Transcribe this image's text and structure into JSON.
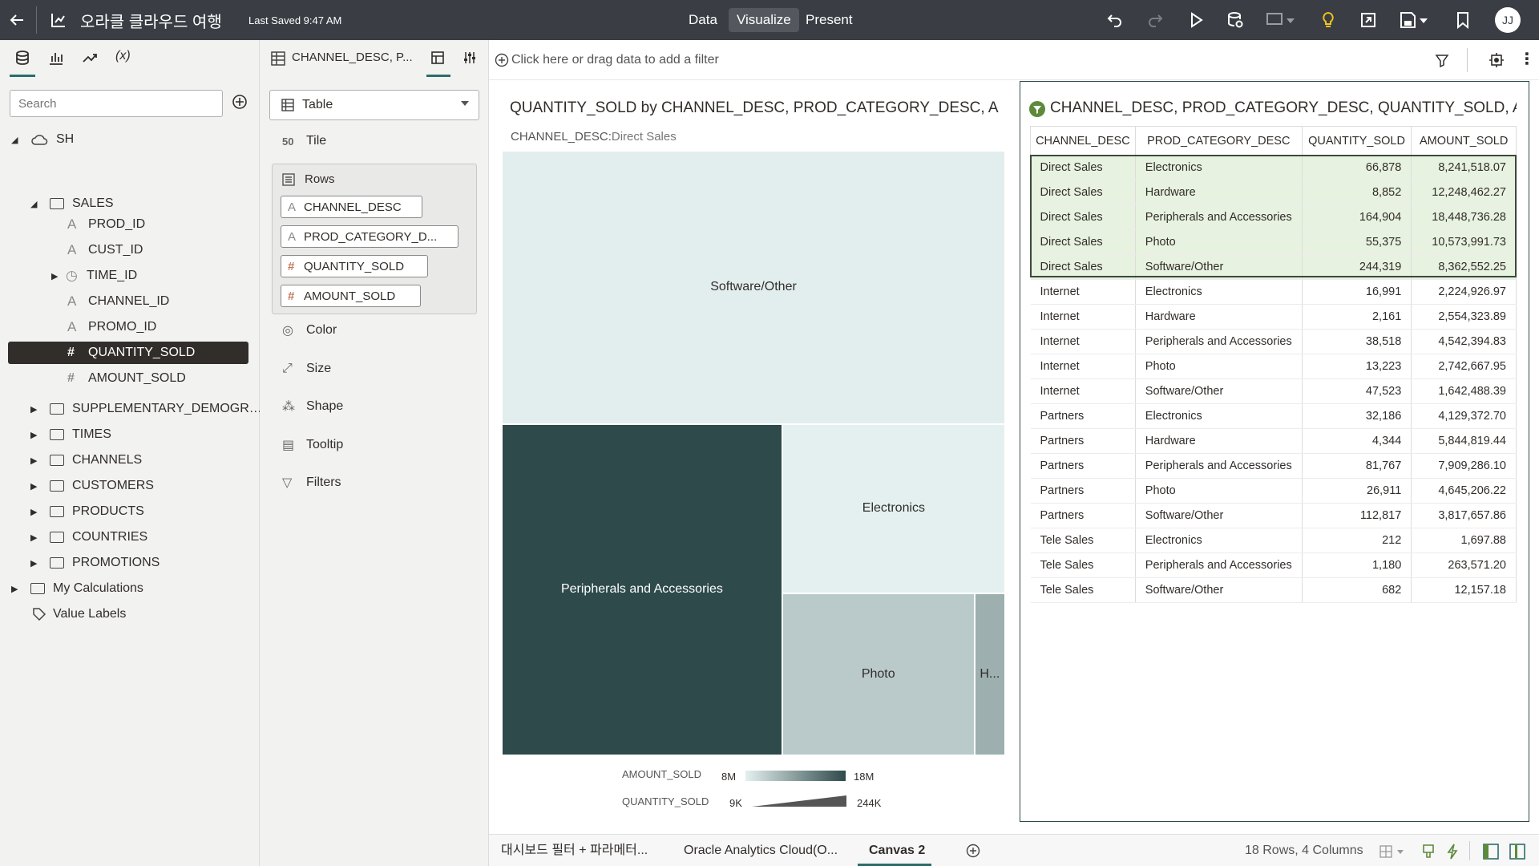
{
  "app": {
    "title": "오라클 클라우드 여행",
    "last_saved": "Last Saved 9:47 AM",
    "tabs": [
      "Data",
      "Visualize",
      "Present"
    ],
    "active_tab": "Visualize",
    "user_initials": "JJ"
  },
  "left_panel": {
    "icons": [
      "data-icon",
      "visualizations-icon",
      "analytics-icon",
      "calculations-icon"
    ],
    "calc_label": "(x)",
    "search_placeholder": "Search",
    "tree": {
      "root": "SH",
      "sales_folder": "SALES",
      "sales_columns": [
        {
          "label": "PROD_ID",
          "type": "text"
        },
        {
          "label": "CUST_ID",
          "type": "text"
        },
        {
          "label": "TIME_ID",
          "type": "time"
        },
        {
          "label": "CHANNEL_ID",
          "type": "text"
        },
        {
          "label": "PROMO_ID",
          "type": "text"
        },
        {
          "label": "QUANTITY_SOLD",
          "type": "number",
          "selected": true
        },
        {
          "label": "AMOUNT_SOLD",
          "type": "number"
        }
      ],
      "folders": [
        "SUPPLEMENTARY_DEMOGR…",
        "TIMES",
        "CHANNELS",
        "CUSTOMERS",
        "PRODUCTS",
        "COUNTRIES",
        "PROMOTIONS"
      ],
      "my_calculations": "My Calculations",
      "value_labels": "Value Labels"
    }
  },
  "grammar": {
    "header": "CHANNEL_DESC, P...",
    "viz_type": "Table",
    "tile": "Tile",
    "rows_label": "Rows",
    "row_pills": [
      {
        "label": "CHANNEL_DESC",
        "type": "text"
      },
      {
        "label": "PROD_CATEGORY_D...",
        "type": "text"
      },
      {
        "label": "QUANTITY_SOLD",
        "type": "number"
      },
      {
        "label": "AMOUNT_SOLD",
        "type": "number"
      }
    ],
    "sections": [
      "Color",
      "Size",
      "Shape",
      "Tooltip",
      "Filters"
    ]
  },
  "filter_bar": {
    "placeholder": "Click here or drag data to add a filter"
  },
  "treemap": {
    "title": "QUANTITY_SOLD by CHANNEL_DESC, PROD_CATEGORY_DESC, AMOU...",
    "subtitle_key": "CHANNEL_DESC:",
    "subtitle_value": "Direct Sales",
    "color_legend": {
      "label": "AMOUNT_SOLD",
      "min": "8M",
      "max": "18M"
    },
    "size_legend": {
      "label": "QUANTITY_SOLD",
      "min": "9K",
      "max": "244K"
    },
    "colors": {
      "light": "#e4f0f0",
      "dark": "#2e4a4a",
      "mid": "#b3d5d4",
      "teal": "#92c1bf"
    }
  },
  "table_viz": {
    "title": "CHANNEL_DESC, PROD_CATEGORY_DESC, QUANTITY_SOLD, AMOU...",
    "columns": [
      "CHANNEL_DESC",
      "PROD_CATEGORY_DESC",
      "QUANTITY_SOLD",
      "AMOUNT_SOLD"
    ],
    "rows": [
      [
        "Direct Sales",
        "Electronics",
        "66,878",
        "8,241,518.07"
      ],
      [
        "Direct Sales",
        "Hardware",
        "8,852",
        "12,248,462.27"
      ],
      [
        "Direct Sales",
        "Peripherals and Accessories",
        "164,904",
        "18,448,736.28"
      ],
      [
        "Direct Sales",
        "Photo",
        "55,375",
        "10,573,991.73"
      ],
      [
        "Direct Sales",
        "Software/Other",
        "244,319",
        "8,362,552.25"
      ],
      [
        "Internet",
        "Electronics",
        "16,991",
        "2,224,926.97"
      ],
      [
        "Internet",
        "Hardware",
        "2,161",
        "2,554,323.89"
      ],
      [
        "Internet",
        "Peripherals and Accessories",
        "38,518",
        "4,542,394.83"
      ],
      [
        "Internet",
        "Photo",
        "13,223",
        "2,742,667.95"
      ],
      [
        "Internet",
        "Software/Other",
        "47,523",
        "1,642,488.39"
      ],
      [
        "Partners",
        "Electronics",
        "32,186",
        "4,129,372.70"
      ],
      [
        "Partners",
        "Hardware",
        "4,344",
        "5,844,819.44"
      ],
      [
        "Partners",
        "Peripherals and Accessories",
        "81,767",
        "7,909,286.10"
      ],
      [
        "Partners",
        "Photo",
        "26,911",
        "4,645,206.22"
      ],
      [
        "Partners",
        "Software/Other",
        "112,817",
        "3,817,657.86"
      ],
      [
        "Tele Sales",
        "Electronics",
        "212",
        "1,697.88"
      ],
      [
        "Tele Sales",
        "Peripherals and Accessories",
        "1,180",
        "263,571.20"
      ],
      [
        "Tele Sales",
        "Software/Other",
        "682",
        "12,157.18"
      ]
    ],
    "selected_rows": 5
  },
  "bottom": {
    "canvas_tabs": [
      "대시보드 필터 + 파라메터...",
      "Oracle Analytics Cloud(O...",
      "Canvas 2"
    ],
    "active_canvas": "Canvas 2",
    "status": "18 Rows, 4 Columns"
  },
  "chart_data": {
    "type": "treemap",
    "title": "QUANTITY_SOLD by CHANNEL_DESC, PROD_CATEGORY_DESC, AMOU...",
    "filter": "CHANNEL_DESC: Direct Sales",
    "categories": [
      "Software/Other",
      "Peripherals and Accessories",
      "Electronics",
      "Photo",
      "Hardware"
    ],
    "tile_labels": [
      "Software/Other",
      "Peripherals and Accessories",
      "Electronics",
      "Photo",
      "H..."
    ],
    "size_values": [
      244319,
      164904,
      66878,
      55375,
      8852
    ],
    "color_values": [
      8362552.25,
      18448736.28,
      8241518.07,
      10573991.73,
      12248462.27
    ]
  }
}
